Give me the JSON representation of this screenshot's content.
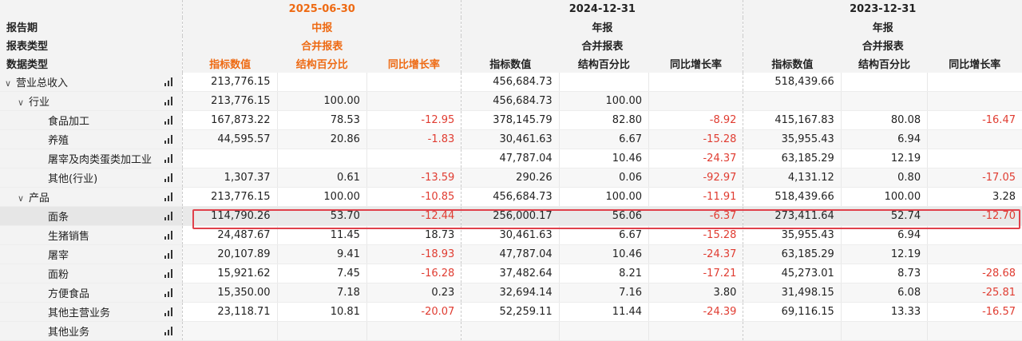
{
  "header": {
    "row_labels": {
      "period": "报告期",
      "report_type": "报表类型",
      "data_type": "数据类型"
    },
    "periods": [
      {
        "date": "2025-06-30",
        "kind": "中报",
        "scope": "合并报表",
        "highlight": true
      },
      {
        "date": "2024-12-31",
        "kind": "年报",
        "scope": "合并报表",
        "highlight": false
      },
      {
        "date": "2023-12-31",
        "kind": "年报",
        "scope": "合并报表",
        "highlight": false
      }
    ],
    "col_labels": {
      "value": "指标数值",
      "pct": "结构百分比",
      "growth": "同比增长率"
    }
  },
  "rows": [
    {
      "name": "营业总收入",
      "level": 0,
      "expand": "∨",
      "cells": [
        "213,776.15",
        "",
        "",
        "456,684.73",
        "",
        "",
        "518,439.66",
        "",
        ""
      ]
    },
    {
      "name": "行业",
      "level": 1,
      "expand": "∨",
      "cells": [
        "213,776.15",
        "100.00",
        "",
        "456,684.73",
        "100.00",
        "",
        "",
        "",
        ""
      ]
    },
    {
      "name": "食品加工",
      "level": 2,
      "expand": "",
      "cells": [
        "167,873.22",
        "78.53",
        "-12.95",
        "378,145.79",
        "82.80",
        "-8.92",
        "415,167.83",
        "80.08",
        "-16.47"
      ]
    },
    {
      "name": "养殖",
      "level": 2,
      "expand": "",
      "cells": [
        "44,595.57",
        "20.86",
        "-1.83",
        "30,461.63",
        "6.67",
        "-15.28",
        "35,955.43",
        "6.94",
        ""
      ]
    },
    {
      "name": "屠宰及肉类蛋类加工业",
      "level": 2,
      "expand": "",
      "cells": [
        "",
        "",
        "",
        "47,787.04",
        "10.46",
        "-24.37",
        "63,185.29",
        "12.19",
        ""
      ]
    },
    {
      "name": "其他(行业)",
      "level": 2,
      "expand": "",
      "cells": [
        "1,307.37",
        "0.61",
        "-13.59",
        "290.26",
        "0.06",
        "-92.97",
        "4,131.12",
        "0.80",
        "-17.05"
      ]
    },
    {
      "name": "产品",
      "level": 1,
      "expand": "∨",
      "cells": [
        "213,776.15",
        "100.00",
        "-10.85",
        "456,684.73",
        "100.00",
        "-11.91",
        "518,439.66",
        "100.00",
        "3.28"
      ]
    },
    {
      "name": "面条",
      "level": 2,
      "expand": "",
      "highlighted": true,
      "cells": [
        "114,790.26",
        "53.70",
        "-12.44",
        "256,000.17",
        "56.06",
        "-6.37",
        "273,411.64",
        "52.74",
        "-12.70"
      ]
    },
    {
      "name": "生猪销售",
      "level": 2,
      "expand": "",
      "cells": [
        "24,487.67",
        "11.45",
        "18.73",
        "30,461.63",
        "6.67",
        "-15.28",
        "35,955.43",
        "6.94",
        ""
      ]
    },
    {
      "name": "屠宰",
      "level": 2,
      "expand": "",
      "cells": [
        "20,107.89",
        "9.41",
        "-18.93",
        "47,787.04",
        "10.46",
        "-24.37",
        "63,185.29",
        "12.19",
        ""
      ]
    },
    {
      "name": "面粉",
      "level": 2,
      "expand": "",
      "cells": [
        "15,921.62",
        "7.45",
        "-16.28",
        "37,482.64",
        "8.21",
        "-17.21",
        "45,273.01",
        "8.73",
        "-28.68"
      ]
    },
    {
      "name": "方便食品",
      "level": 2,
      "expand": "",
      "cells": [
        "15,350.00",
        "7.18",
        "0.23",
        "32,694.14",
        "7.16",
        "3.80",
        "31,498.15",
        "6.08",
        "-25.81"
      ]
    },
    {
      "name": "其他主营业务",
      "level": 2,
      "expand": "",
      "cells": [
        "23,118.71",
        "10.81",
        "-20.07",
        "52,259.11",
        "11.44",
        "-24.39",
        "69,116.15",
        "13.33",
        "-16.57"
      ]
    },
    {
      "name": "其他业务",
      "level": 2,
      "expand": "",
      "cells": [
        "",
        "",
        "",
        "",
        "",
        "",
        "",
        "",
        ""
      ]
    }
  ],
  "colors": {
    "accent_orange": "#ee6a13",
    "negative_red": "#e03c31",
    "highlight_border": "#e0414b"
  }
}
